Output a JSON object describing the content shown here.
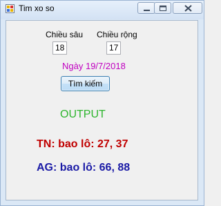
{
  "window": {
    "title": "Tim xo so"
  },
  "form": {
    "depth_label": "Chiều sâu",
    "depth_value": "18",
    "width_label": "Chiều rộng",
    "width_value": "17",
    "date_text": "Ngày 19/7/2018",
    "search_button_label": "Tìm kiếm"
  },
  "output": {
    "heading": "OUTPUT",
    "results": [
      {
        "text": "TN: bao lô: 27, 37",
        "color": "#c00000"
      },
      {
        "text": "AG: bao lô: 66, 88",
        "color": "#1a1aa6"
      }
    ]
  },
  "colors": {
    "date": "#c000c0",
    "output_heading": "#2db52d"
  },
  "icons": {
    "app": "app-icon",
    "minimize": "minimize-icon",
    "maximize": "maximize-icon",
    "close": "close-icon"
  }
}
